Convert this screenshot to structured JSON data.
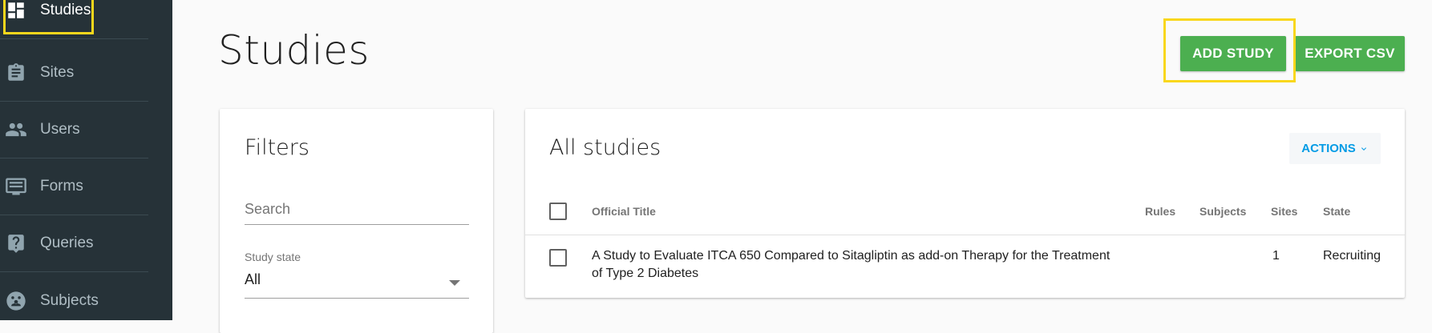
{
  "sidebar": {
    "items": [
      {
        "label": "Studies",
        "icon": "dashboard-icon"
      },
      {
        "label": "Sites",
        "icon": "clipboard-icon"
      },
      {
        "label": "Users",
        "icon": "people-icon"
      },
      {
        "label": "Forms",
        "icon": "form-icon"
      },
      {
        "label": "Queries",
        "icon": "help-icon"
      },
      {
        "label": "Subjects",
        "icon": "subjects-icon"
      }
    ]
  },
  "header": {
    "title": "Studies",
    "add_label": "ADD STUDY",
    "export_label": "EXPORT CSV"
  },
  "filters": {
    "title": "Filters",
    "search_placeholder": "Search",
    "state_label": "Study state",
    "state_value": "All"
  },
  "studies": {
    "title": "All studies",
    "actions_label": "ACTIONS",
    "columns": [
      "Official Title",
      "Rules",
      "Subjects",
      "Sites",
      "State"
    ],
    "rows": [
      {
        "title_line1": "A Study to Evaluate ITCA 650 Compared to Sitagliptin as add-on Therapy for the Treatment",
        "title_line2": "of Type 2 Diabetes",
        "rules": "",
        "subjects": "",
        "sites": "1",
        "state": "Recruiting"
      }
    ]
  },
  "colors": {
    "sidebar_bg": "#263238",
    "primary_green": "#4caf50",
    "accent_blue": "#039be5",
    "highlight": "#f9d71c"
  }
}
